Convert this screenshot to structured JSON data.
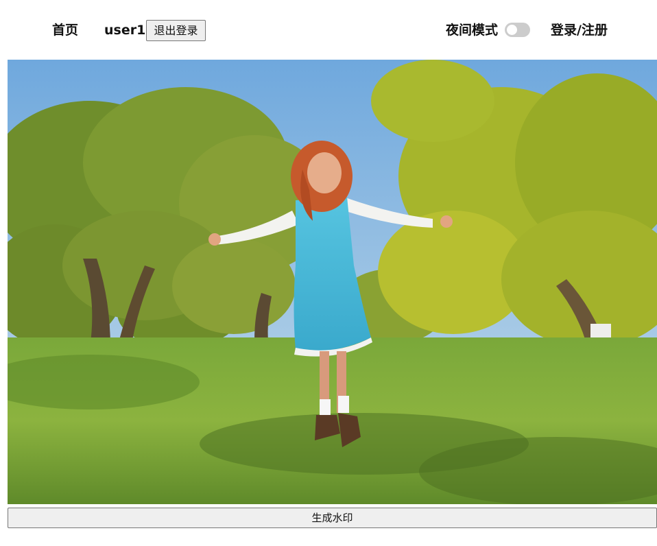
{
  "nav": {
    "home": "首页",
    "username": "user1",
    "logout_button": "退出登录",
    "night_mode_label": "夜间模式",
    "night_mode_on": false,
    "login_register": "登录/注册"
  },
  "main": {
    "photo_alt": "photo",
    "watermark_button": "生成水印"
  }
}
